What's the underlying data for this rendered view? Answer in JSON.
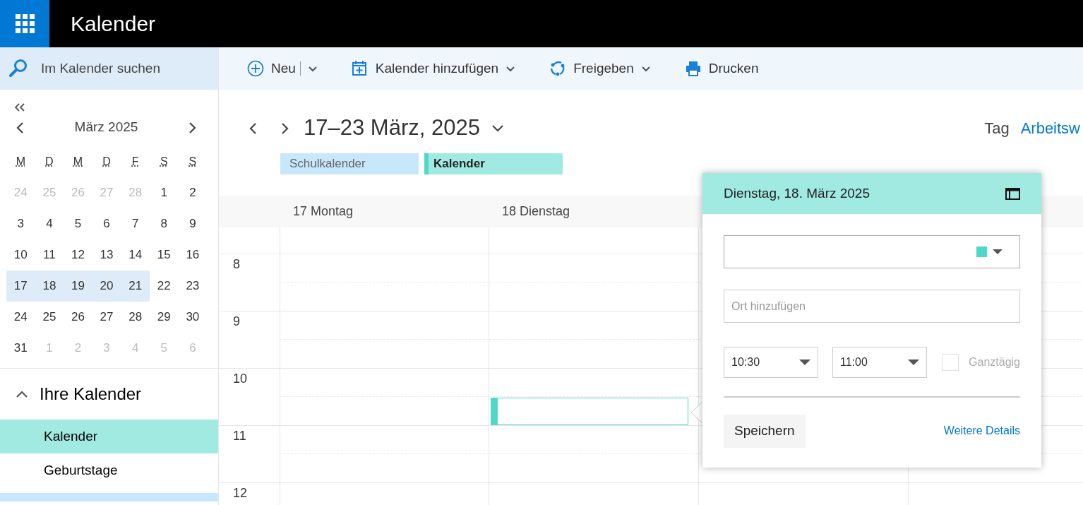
{
  "app": {
    "title": "Kalender"
  },
  "search": {
    "placeholder": "Im Kalender suchen"
  },
  "toolbar": [
    {
      "label": "Neu",
      "kind": "split"
    },
    {
      "label": "Kalender hinzufügen",
      "kind": "dropdown"
    },
    {
      "label": "Freigeben",
      "kind": "dropdown"
    },
    {
      "label": "Drucken",
      "kind": "button"
    }
  ],
  "mini_calendar": {
    "month": "März 2025",
    "weekdays": [
      "M",
      "D",
      "M",
      "D",
      "F",
      "S",
      "S"
    ],
    "weeks": [
      [
        {
          "day": "24",
          "muted": true,
          "selected": false
        },
        {
          "day": "25",
          "muted": true,
          "selected": false
        },
        {
          "day": "26",
          "muted": true,
          "selected": false
        },
        {
          "day": "27",
          "muted": true,
          "selected": false
        },
        {
          "day": "28",
          "muted": true,
          "selected": false
        },
        {
          "day": "1",
          "muted": false,
          "selected": false
        },
        {
          "day": "2",
          "muted": false,
          "selected": false
        }
      ],
      [
        {
          "day": "3",
          "muted": false,
          "selected": false
        },
        {
          "day": "4",
          "muted": false,
          "selected": false
        },
        {
          "day": "5",
          "muted": false,
          "selected": false
        },
        {
          "day": "6",
          "muted": false,
          "selected": false
        },
        {
          "day": "7",
          "muted": false,
          "selected": false
        },
        {
          "day": "8",
          "muted": false,
          "selected": false
        },
        {
          "day": "9",
          "muted": false,
          "selected": false
        }
      ],
      [
        {
          "day": "10",
          "muted": false,
          "selected": false
        },
        {
          "day": "11",
          "muted": false,
          "selected": false
        },
        {
          "day": "12",
          "muted": false,
          "selected": false
        },
        {
          "day": "13",
          "muted": false,
          "selected": false
        },
        {
          "day": "14",
          "muted": false,
          "selected": false
        },
        {
          "day": "15",
          "muted": false,
          "selected": false
        },
        {
          "day": "16",
          "muted": false,
          "selected": false
        }
      ],
      [
        {
          "day": "17",
          "muted": false,
          "selected": true
        },
        {
          "day": "18",
          "muted": false,
          "selected": true
        },
        {
          "day": "19",
          "muted": false,
          "selected": true
        },
        {
          "day": "20",
          "muted": false,
          "selected": true
        },
        {
          "day": "21",
          "muted": false,
          "selected": true
        },
        {
          "day": "22",
          "muted": false,
          "selected": false
        },
        {
          "day": "23",
          "muted": false,
          "selected": false
        }
      ],
      [
        {
          "day": "24",
          "muted": false,
          "selected": false
        },
        {
          "day": "25",
          "muted": false,
          "selected": false
        },
        {
          "day": "26",
          "muted": false,
          "selected": false
        },
        {
          "day": "27",
          "muted": false,
          "selected": false
        },
        {
          "day": "28",
          "muted": false,
          "selected": false
        },
        {
          "day": "29",
          "muted": false,
          "selected": false
        },
        {
          "day": "30",
          "muted": false,
          "selected": false
        }
      ],
      [
        {
          "day": "31",
          "muted": false,
          "selected": false
        },
        {
          "day": "1",
          "muted": true,
          "selected": false
        },
        {
          "day": "2",
          "muted": true,
          "selected": false
        },
        {
          "day": "3",
          "muted": true,
          "selected": false
        },
        {
          "day": "4",
          "muted": true,
          "selected": false
        },
        {
          "day": "5",
          "muted": true,
          "selected": false
        },
        {
          "day": "6",
          "muted": true,
          "selected": false
        }
      ]
    ]
  },
  "sidebar": {
    "section": "Ihre Kalender",
    "expanded": true,
    "items": [
      {
        "label": "Kalender",
        "selected": true
      },
      {
        "label": "Geburtstage",
        "selected": false
      }
    ]
  },
  "week_nav": {
    "range": "17–23 März, 2025"
  },
  "views": [
    {
      "label": "Tag",
      "selected": false
    },
    {
      "label": "Arbeitsw",
      "selected": true
    }
  ],
  "calendar_tags": [
    {
      "label": "Schulkalender",
      "selected": false,
      "color": "#c7e7fb"
    },
    {
      "label": "Kalender",
      "selected": true,
      "color": "#a0eae2"
    }
  ],
  "day_columns": [
    {
      "label": "17 Montag"
    },
    {
      "label": "18 Dienstag"
    }
  ],
  "hours": [
    "8",
    "9",
    "10",
    "11",
    "12"
  ],
  "popup": {
    "date": "Dienstag, 18. März 2025",
    "location_placeholder": "Ort hinzufügen",
    "start": "10:30",
    "end": "11:00",
    "all_day": {
      "label": "Ganztägig",
      "checked": false
    },
    "save": "Speichern",
    "more": "Weitere Details"
  }
}
